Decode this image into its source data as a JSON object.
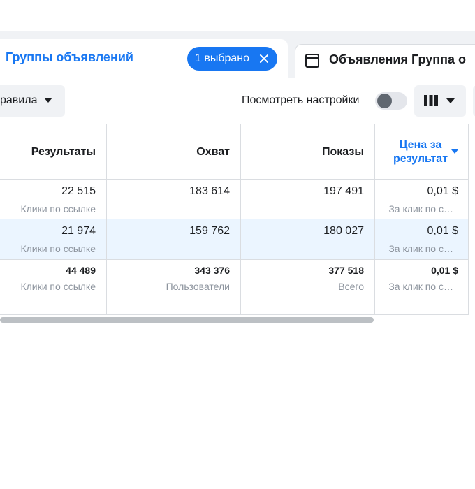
{
  "tabs": {
    "active_label": "Группы объявлений",
    "selected_badge": "1 выбрано",
    "inactive_label": "Объявления Группа о"
  },
  "toolbar": {
    "rules_label": "равила",
    "view_settings_label": "Посмотреть настройки",
    "view_settings_toggle_on": false
  },
  "table": {
    "columns": [
      {
        "label": "Результаты"
      },
      {
        "label": "Охват"
      },
      {
        "label": "Показы"
      },
      {
        "label_line1": "Цена за",
        "label_line2": "результат",
        "sorted": true
      }
    ],
    "rows": [
      {
        "results": "22 515",
        "results_sub": "Клики по ссылке",
        "reach": "183 614",
        "impressions": "197 491",
        "cost": "0,01 $",
        "cost_sub": "За клик по с…"
      },
      {
        "results": "21 974",
        "results_sub": "Клики по ссылке",
        "reach": "159 762",
        "impressions": "180 027",
        "cost": "0,01 $",
        "cost_sub": "За клик по с…",
        "highlighted": true
      }
    ],
    "totals": {
      "results": "44 489",
      "results_sub": "Клики по ссылке",
      "reach": "343 376",
      "reach_sub": "Пользователи",
      "impressions": "377 518",
      "impressions_sub": "Всего",
      "cost": "0,01 $",
      "cost_sub": "За клик по с…"
    }
  },
  "colors": {
    "accent": "#1877f2",
    "highlight_row": "#ebf5ff",
    "muted_text": "#8d949e"
  }
}
